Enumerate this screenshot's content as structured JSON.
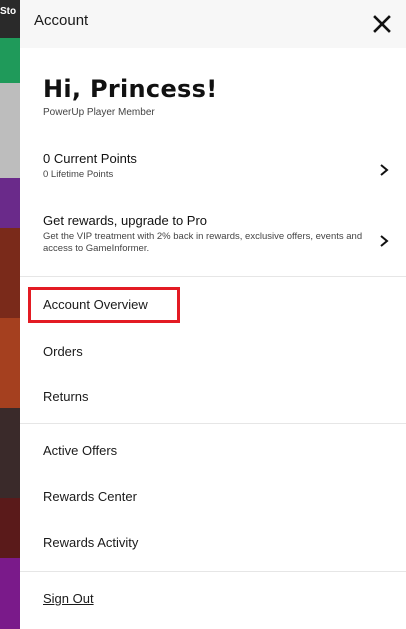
{
  "background": {
    "partial_text": "Sto"
  },
  "drawer": {
    "header_title": "Account",
    "greeting": "Hi, Princess!",
    "membership": "PowerUp Player Member",
    "points": {
      "current": "0 Current Points",
      "lifetime": "0 Lifetime Points"
    },
    "upgrade": {
      "title": "Get rewards, upgrade to Pro",
      "description": "Get the VIP treatment with 2% back in rewards, exclusive offers, events and access to GameInformer."
    },
    "menu": {
      "account_overview": "Account Overview",
      "orders": "Orders",
      "returns": "Returns",
      "active_offers": "Active Offers",
      "rewards_center": "Rewards Center",
      "rewards_activity": "Rewards Activity",
      "sign_out": "Sign Out"
    }
  },
  "colors": {
    "highlight": "#e31b23",
    "header_bg": "#f7f7f7",
    "text": "#111111"
  },
  "icons": {
    "close": "close-icon",
    "chevron": "chevron-right-icon"
  }
}
